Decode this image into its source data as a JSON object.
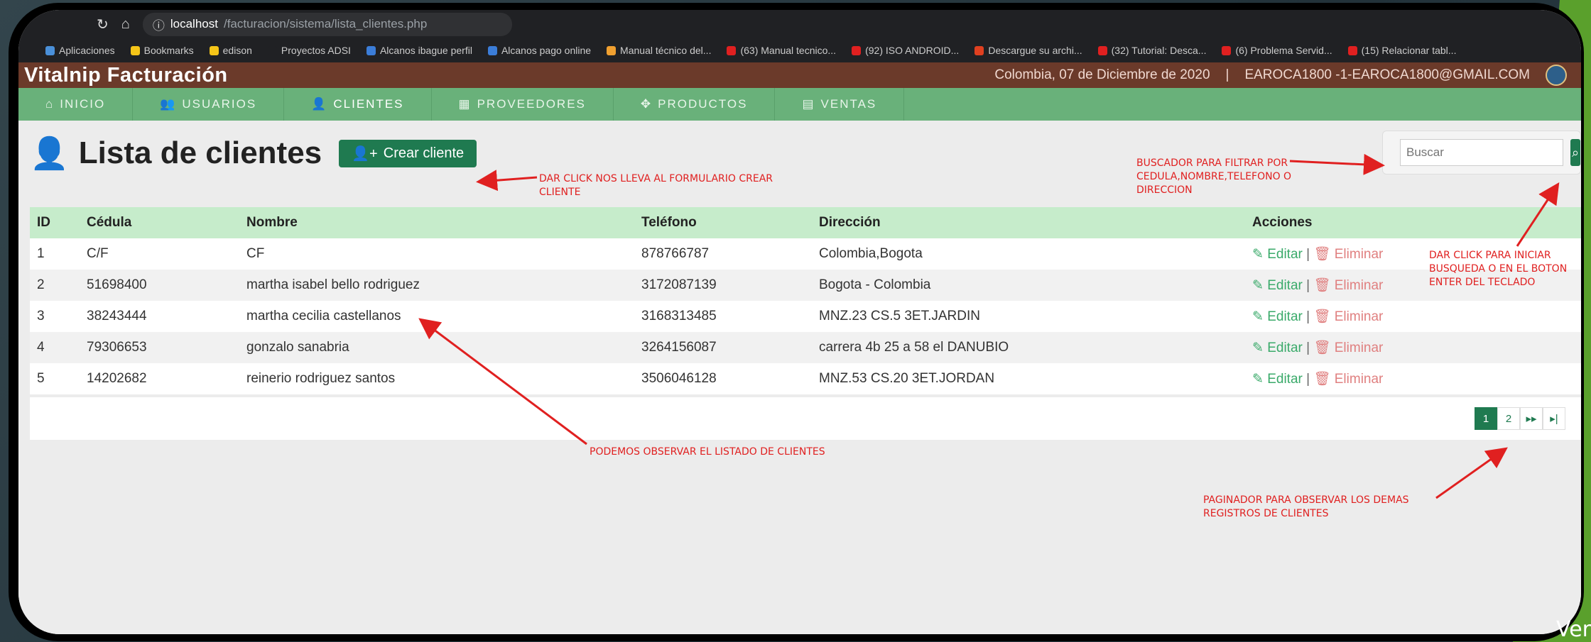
{
  "browser": {
    "url_host": "localhost",
    "url_path": "/facturacion/sistema/lista_clientes.php",
    "bookmarks": [
      {
        "label": "Aplicaciones",
        "color": "#4a90d9"
      },
      {
        "label": "Bookmarks",
        "color": "#f5c518"
      },
      {
        "label": "edison",
        "color": "#f5c518"
      },
      {
        "label": "Proyectos ADSI",
        "color": "#202124"
      },
      {
        "label": "Alcanos ibague perfil",
        "color": "#3b7dd8"
      },
      {
        "label": "Alcanos pago online",
        "color": "#3b7dd8"
      },
      {
        "label": "Manual técnico del...",
        "color": "#f0a030"
      },
      {
        "label": "(63) Manual tecnico...",
        "color": "#e02020"
      },
      {
        "label": "(92) ISO ANDROID...",
        "color": "#e02020"
      },
      {
        "label": "Descargue su archi...",
        "color": "#e04020"
      },
      {
        "label": "(32) Tutorial: Desca...",
        "color": "#e02020"
      },
      {
        "label": "(6) Problema Servid...",
        "color": "#e02020"
      },
      {
        "label": "(15) Relacionar tabl...",
        "color": "#e02020"
      }
    ]
  },
  "header": {
    "brand": "Vitalnip Facturación",
    "date": "Colombia, 07 de Diciembre de 2020",
    "separator": "|",
    "user": "EAROCA1800 -1-EAROCA1800@GMAIL.COM"
  },
  "nav": [
    {
      "label": "INICIO",
      "icon": "⌂"
    },
    {
      "label": "USUARIOS",
      "icon": "👥"
    },
    {
      "label": "CLIENTES",
      "icon": "👤"
    },
    {
      "label": "PROVEEDORES",
      "icon": "▦"
    },
    {
      "label": "PRODUCTOS",
      "icon": "✥"
    },
    {
      "label": "VENTAS",
      "icon": "▤"
    }
  ],
  "page": {
    "title": "Lista de clientes",
    "create_button": "Crear cliente",
    "search_placeholder": "Buscar"
  },
  "table": {
    "headers": [
      "ID",
      "Cédula",
      "Nombre",
      "Teléfono",
      "Dirección",
      "Acciones"
    ],
    "rows": [
      [
        "1",
        "C/F",
        "CF",
        "878766787",
        "Colombia,Bogota"
      ],
      [
        "2",
        "51698400",
        "martha isabel bello rodriguez",
        "3172087139",
        "Bogota - Colombia"
      ],
      [
        "3",
        "38243444",
        "martha cecilia castellanos",
        "3168313485",
        "MNZ.23 CS.5 3ET.JARDIN"
      ],
      [
        "4",
        "79306653",
        "gonzalo sanabria",
        "3264156087",
        "carrera 4b 25 a 58 el DANUBIO"
      ],
      [
        "5",
        "14202682",
        "reinerio rodriguez santos",
        "3506046128",
        "MNZ.53 CS.20 3ET.JORDAN"
      ]
    ],
    "edit_label": "Editar",
    "delete_label": "Eliminar"
  },
  "pager": [
    "1",
    "2",
    "▸▸",
    "▸|"
  ],
  "notes": {
    "create": [
      "DAR CLICK NOS LLEVA AL FORMULARIO CREAR",
      "CLIENTE"
    ],
    "search": [
      "BUSCADOR PARA FILTRAR POR",
      "CEDULA,NOMBRE,TELEFONO O",
      "DIRECCION"
    ],
    "search_btn": [
      "DAR CLICK PARA INICIAR",
      "BUSQUEDA O EN EL BOTON",
      "ENTER DEL TECLADO"
    ],
    "list": [
      "PODEMOS OBSERVAR EL LISTADO DE CLIENTES"
    ],
    "pager": [
      "PAGINADOR PARA OBSERVAR LOS DEMAS",
      "REGISTROS DE CLIENTES"
    ]
  },
  "corner_text": "Ver",
  "colors": {
    "header": "#6b3a2a",
    "nav": "#69b17a",
    "accent": "#1f7a50",
    "table_head": "#c6eccb",
    "annotation": "#e02020"
  }
}
